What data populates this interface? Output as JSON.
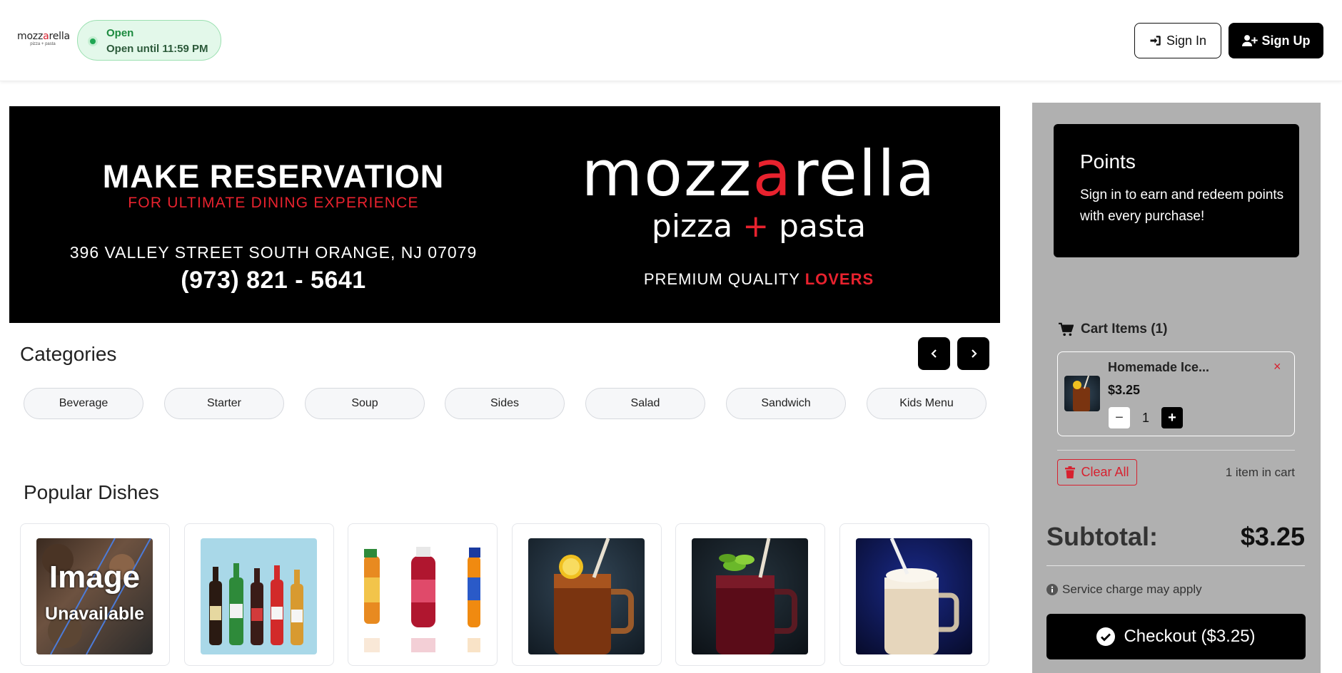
{
  "header": {
    "logo_word_a": "mozz",
    "logo_word_b": "a",
    "logo_word_c": "rella",
    "logo_sub": "pizza + pasta",
    "status": "Open",
    "status_detail": "Open until 11:59 PM",
    "sign_in": "Sign In",
    "sign_up": "Sign Up"
  },
  "banner": {
    "title": "MAKE RESERVATION",
    "subtitle": "FOR ULTIMATE DINING EXPERIENCE",
    "address": "396 VALLEY STREET SOUTH ORANGE, NJ 07079",
    "phone": "(973) 821 - 5641",
    "logo_a": "mozz",
    "logo_b": "a",
    "logo_c": "rella",
    "logo2_a": "pizza ",
    "logo2_plus": "+",
    "logo2_b": " pasta",
    "tag_a": "PREMIUM QUALITY ",
    "tag_b": "LOVERS"
  },
  "categories": {
    "title": "Categories",
    "items": [
      "Beverage",
      "Starter",
      "Soup",
      "Sides",
      "Salad",
      "Sandwich",
      "Kids Menu"
    ]
  },
  "popular": {
    "title": "Popular Dishes",
    "unavailable_line1": "Image",
    "unavailable_line2": "Unavailable"
  },
  "points": {
    "title": "Points",
    "text": "Sign in to earn and redeem points with every purchase!"
  },
  "cart": {
    "heading": "Cart Items (1)",
    "item_name": "Homemade Ice...",
    "item_price": "$3.25",
    "item_qty": "1",
    "remove": "×",
    "minus": "−",
    "plus": "+",
    "clear_all": "Clear All",
    "count_text": "1 item in cart",
    "subtotal_label": "Subtotal:",
    "subtotal_value": "$3.25",
    "service_note": "Service charge may apply",
    "checkout": "Checkout ($3.25)"
  },
  "colors": {
    "accent_red": "#d7212f",
    "open_green": "#1b8a3e",
    "sidebar_gray": "#b0b0b0"
  }
}
